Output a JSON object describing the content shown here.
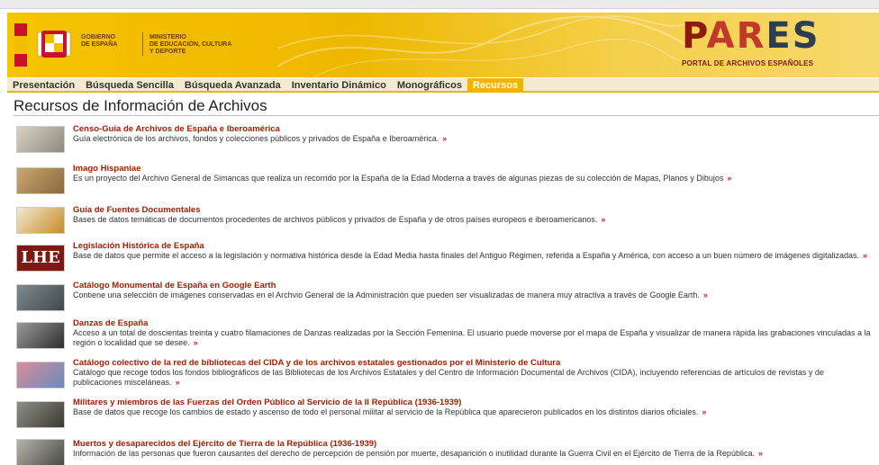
{
  "header": {
    "gov_line1": "GOBIERNO",
    "gov_line2": "DE ESPAÑA",
    "min_line1": "MINISTERIO",
    "min_line2": "DE EDUCACIÓN, CULTURA",
    "min_line3": "Y DEPORTE",
    "logo_text": "PARES",
    "logo_sub": "PORTAL DE ARCHIVOS ESPAÑOLES"
  },
  "nav": {
    "items": [
      "Presentación",
      "Búsqueda Sencilla",
      "Búsqueda Avanzada",
      "Inventario Dinámico",
      "Monográficos",
      "Recursos"
    ],
    "active_index": 5
  },
  "page": {
    "title": "Recursos de Información de Archivos"
  },
  "arrow_glyph": "»",
  "entries": [
    {
      "title": "Censo-Guía de Archivos de España e Iberoamérica",
      "desc": "Guía electrónica de los archivos, fondos y colecciones públicos y privados de España e Iberoamérica.",
      "thumb_icon": "censo-guia-thumbnail"
    },
    {
      "title": "Imago Hispaniae",
      "desc": "Es un proyecto del Archivo General de Simancas que realiza un recorrido por la España de la Edad Moderna a través de algunas piezas de su colección de Mapas, Planos y Dibujos",
      "thumb_icon": "imago-hispaniae-thumbnail"
    },
    {
      "title": "Guía de Fuentes Documentales",
      "desc": "Bases de datos temáticas de documentos procedentes de archivos públicos y privados de España y de otros países europeos e iberoamericanos.",
      "thumb_icon": "guia-fuentes-thumbnail"
    },
    {
      "title": "Legislación Histórica de España",
      "desc": "Base de datos que permite el acceso a la legislación y normativa histórica desde la Edad Media hasta finales del Antiguo Régimen, referida a España y América, con acceso a un buen número de imágenes digitalizadas.",
      "thumb_icon": "lhe-logo-thumbnail",
      "thumb_text": "LHE"
    },
    {
      "title": "Catálogo Monumental de España en Google Earth",
      "desc": "Contiene una selección de imágenes conservadas en el Archvio General de la Administración que pueden ser visualizadas de manera muy atractiva a través de Google Earth.",
      "thumb_icon": "monumento-photo-thumbnail"
    },
    {
      "title": "Danzas de España",
      "desc": "Acceso a un total de doscientas treinta y cuatro filamaciones de Danzas realizadas por la Sección Femenina. El usuario puede moverse por el mapa de España y visualizar de manera rápida las grabaciones vinculadas a la región o localidad que se desee.",
      "thumb_icon": "danzas-photo-thumbnail"
    },
    {
      "title": "Catálogo colectivo de la red de bibliotecas del CIDA y de los archivos estatales gestionados por el Ministerio de Cultura",
      "desc": "Catálogo que recoge todos los fondos bibliográficos de las Bibliotecas de los Archivos Estatales y del Centro de Información Documental de Archivos (CIDA), incluyendo referencias de artículos de revistas y de publicaciones misceláneas.",
      "thumb_icon": "catalogo-colectivo-thumbnail"
    },
    {
      "title": "Militares y miembros de las Fuerzas del Orden Público al Servicio de la II República (1936-1939)",
      "desc": "Base de datos que recoge los cambios de estado y ascenso de todo el personal militar al servicio de la República que aparecieron publicados en los distintos diarios oficiales.",
      "thumb_icon": "militares-photo-thumbnail"
    },
    {
      "title": "Muertos y desaparecidos del Ejército de Tierra de la República (1936-1939)",
      "desc": "Información de las personas que fueron causantes del derecho de percepción de pensión por muerte, desaparición o inutilidad durante la Guerra Civil en el Ejército de Tierra de la República.",
      "thumb_icon": "muertos-photo-thumbnail"
    }
  ]
}
